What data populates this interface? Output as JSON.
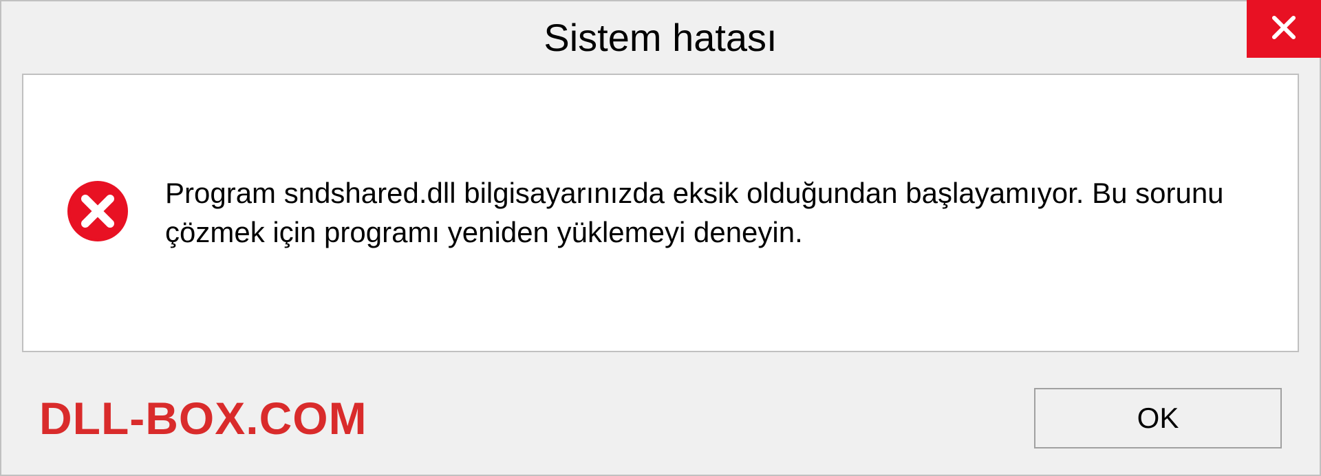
{
  "dialog": {
    "title": "Sistem hatası",
    "message": "Program sndshared.dll bilgisayarınızda eksik olduğundan başlayamıyor. Bu sorunu çözmek için programı yeniden yüklemeyi deneyin.",
    "ok_label": "OK"
  },
  "watermark": {
    "text": "DLL-BOX.COM"
  },
  "colors": {
    "close_button": "#e81123",
    "error_icon": "#e81123",
    "watermark": "#d92b2b"
  }
}
